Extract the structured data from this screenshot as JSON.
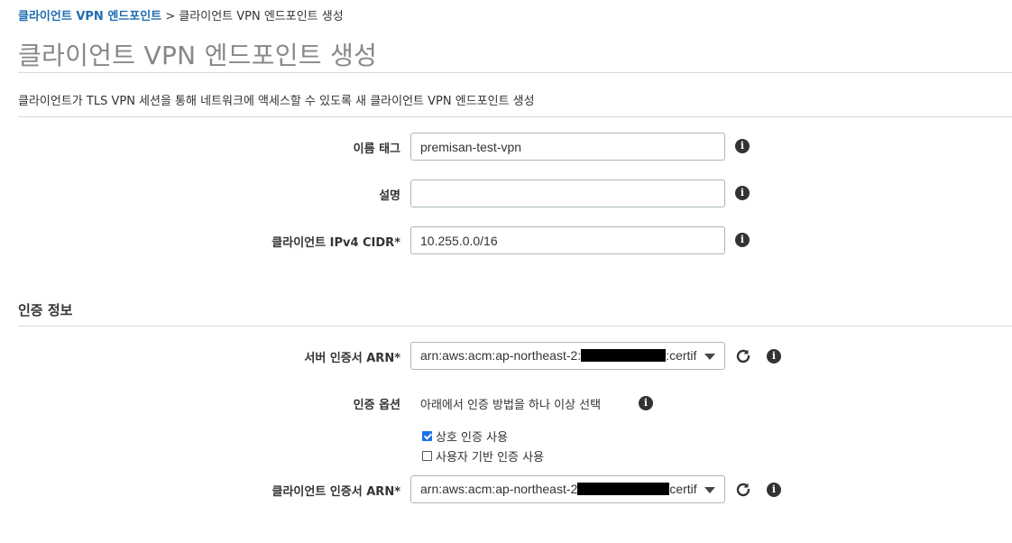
{
  "breadcrumb": {
    "parent_link": "클라이언트 VPN 엔드포인트",
    "separator": ">",
    "current": "클라이언트 VPN 엔드포인트 생성"
  },
  "page": {
    "title": "클라이언트 VPN 엔드포인트 생성",
    "description": "클라이언트가 TLS VPN 세션을 통해 네트워크에 액세스할 수 있도록 새 클라이언트 VPN 엔드포인트 생성"
  },
  "form": {
    "name_tag": {
      "label": "이름 태그",
      "value": "premisan-test-vpn"
    },
    "description": {
      "label": "설명",
      "value": ""
    },
    "client_cidr": {
      "label": "클라이언트 IPv4 CIDR*",
      "value": "10.255.0.0/16"
    }
  },
  "auth": {
    "section_title": "인증 정보",
    "server_cert": {
      "label": "서버 인증서 ARN*",
      "value_prefix": "arn:aws:acm:ap-northeast-2:",
      "value_suffix": ":certif"
    },
    "options": {
      "label": "인증 옵션",
      "hint": "아래에서 인증 방법을 하나 이상 선택",
      "mutual": {
        "label": "상호 인증 사용",
        "checked": true
      },
      "user_based": {
        "label": "사용자 기반 인증 사용",
        "checked": false
      }
    },
    "client_cert": {
      "label": "클라이언트 인증서 ARN*",
      "value_prefix": "arn:aws:acm:ap-northeast-2",
      "value_suffix": "certif"
    }
  },
  "icons": {
    "info": "info-circle-icon",
    "refresh": "refresh-icon",
    "dropdown": "caret-down-icon",
    "checkbox_checked": "checkbox-checked-icon",
    "checkbox_unchecked": "checkbox-unchecked-icon"
  },
  "colors": {
    "link": "#1f6db3",
    "title": "#888888",
    "checkbox": "#1a73e8"
  }
}
